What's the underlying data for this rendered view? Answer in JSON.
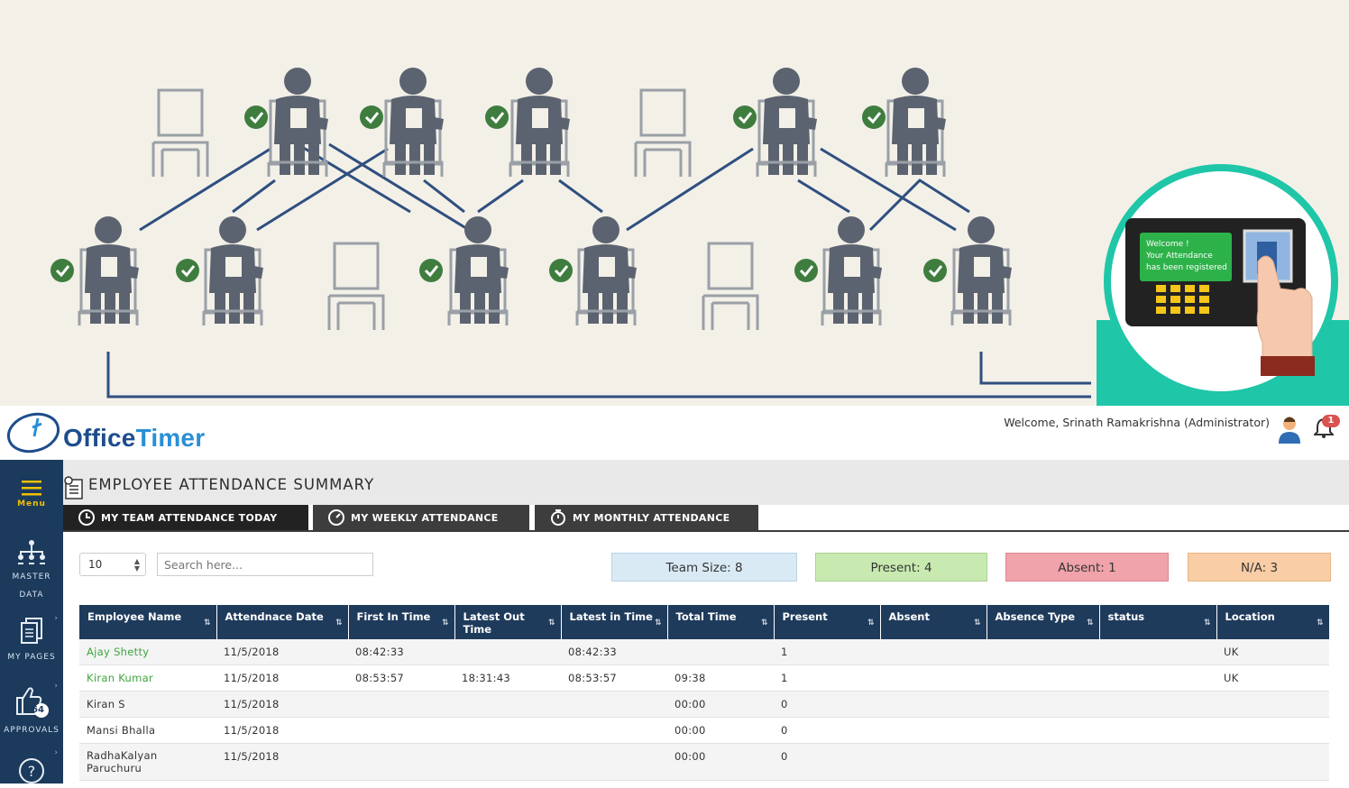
{
  "header": {
    "logo_text_1": "Office",
    "logo_text_2": "Timer",
    "welcome": "Welcome, Srinath Ramakrishna (Administrator)",
    "notification_count": "1"
  },
  "hero": {
    "device_message_lines": [
      "Welcome !",
      "Your Attendance",
      "has been registered"
    ]
  },
  "sidebar": {
    "items": [
      {
        "label": "Menu",
        "icon": "hamburger-icon"
      },
      {
        "label": "MASTER DATA",
        "icon": "org-chart-icon"
      },
      {
        "label": "MY PAGES",
        "icon": "pages-icon"
      },
      {
        "label": "APPROVALS",
        "icon": "thumbs-up-icon",
        "badge": "64"
      },
      {
        "label": "",
        "icon": "help-icon"
      }
    ]
  },
  "page": {
    "title": "EMPLOYEE ATTENDANCE SUMMARY",
    "tabs": [
      {
        "label": "MY TEAM ATTENDANCE TODAY",
        "icon": "clock-icon"
      },
      {
        "label": "MY WEEKLY ATTENDANCE",
        "icon": "timer-icon"
      },
      {
        "label": "MY MONTHLY ATTENDANCE",
        "icon": "stopwatch-icon"
      }
    ]
  },
  "controls": {
    "page_length": "10",
    "search_placeholder": "Search here..."
  },
  "stats": {
    "team_size": "Team Size: 8",
    "present": "Present: 4",
    "absent": "Absent: 1",
    "na": "N/A: 3"
  },
  "colors": {
    "sidebar": "#1b3a5c",
    "table_header": "#1f3b5c",
    "team_size_bg": "#d9eaf5",
    "present_bg": "#c8eab0",
    "absent_bg": "#f0a3aa",
    "na_bg": "#f9cda5",
    "link_green": "#3fa53f"
  },
  "table": {
    "columns": [
      "Employee Name",
      "Attendnace Date",
      "First In Time",
      "Latest Out Time",
      "Latest in Time",
      "Total Time",
      "Present",
      "Absent",
      "Absence Type",
      "status",
      "Location"
    ],
    "rows": [
      [
        "Ajay Shetty",
        "11/5/2018",
        "08:42:33",
        "",
        "08:42:33",
        "",
        "1",
        "",
        "",
        "",
        "UK"
      ],
      [
        "Kiran Kumar",
        "11/5/2018",
        "08:53:57",
        "18:31:43",
        "08:53:57",
        "09:38",
        "1",
        "",
        "",
        "",
        "UK"
      ],
      [
        "Kiran S",
        "11/5/2018",
        "",
        "",
        "",
        "00:00",
        "0",
        "",
        "",
        "",
        ""
      ],
      [
        "Mansi Bhalla",
        "11/5/2018",
        "",
        "",
        "",
        "00:00",
        "0",
        "",
        "",
        "",
        ""
      ],
      [
        "RadhaKalyan Paruchuru",
        "11/5/2018",
        "",
        "",
        "",
        "00:00",
        "0",
        "",
        "",
        "",
        ""
      ]
    ]
  }
}
